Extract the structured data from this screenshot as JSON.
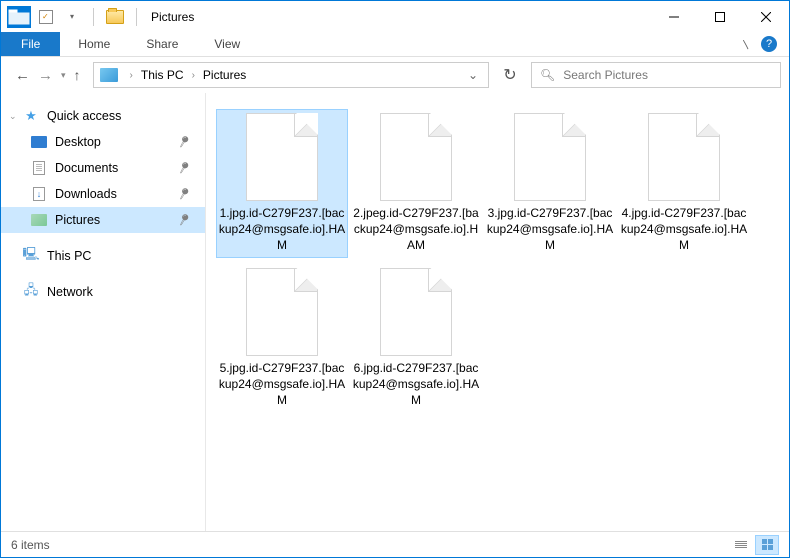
{
  "window": {
    "title": "Pictures",
    "minimize_label": "Minimize",
    "maximize_label": "Maximize",
    "close_label": "Close"
  },
  "ribbon": {
    "file": "File",
    "tabs": [
      "Home",
      "Share",
      "View"
    ]
  },
  "nav": {
    "breadcrumb": [
      "This PC",
      "Pictures"
    ],
    "search_placeholder": "Search Pictures"
  },
  "sidebar": {
    "quick_access": "Quick access",
    "items": [
      {
        "label": "Desktop",
        "pinned": true
      },
      {
        "label": "Documents",
        "pinned": true
      },
      {
        "label": "Downloads",
        "pinned": true
      },
      {
        "label": "Pictures",
        "pinned": true,
        "selected": true
      }
    ],
    "this_pc": "This PC",
    "network": "Network"
  },
  "files": [
    {
      "name": "1.jpg.id-C279F237.[backup24@msgsafe.io].HAM",
      "selected": true
    },
    {
      "name": "2.jpeg.id-C279F237.[backup24@msgsafe.io].HAM",
      "selected": false
    },
    {
      "name": "3.jpg.id-C279F237.[backup24@msgsafe.io].HAM",
      "selected": false
    },
    {
      "name": "4.jpg.id-C279F237.[backup24@msgsafe.io].HAM",
      "selected": false
    },
    {
      "name": "5.jpg.id-C279F237.[backup24@msgsafe.io].HAM",
      "selected": false
    },
    {
      "name": "6.jpg.id-C279F237.[backup24@msgsafe.io].HAM",
      "selected": false
    }
  ],
  "status": {
    "count": "6 items"
  }
}
